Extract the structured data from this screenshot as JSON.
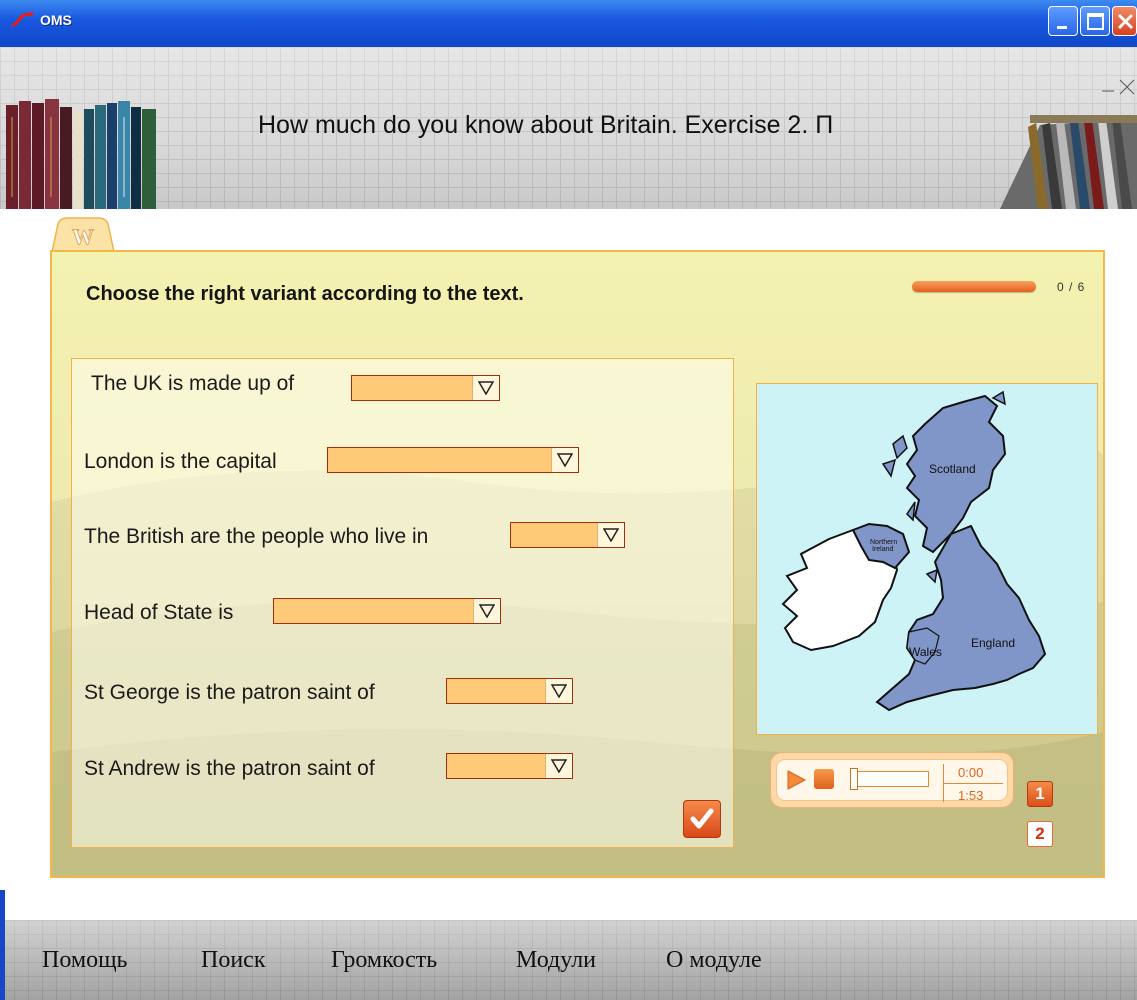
{
  "window": {
    "title": "OMS",
    "icon": "oms-logo-icon",
    "controls": [
      "minimize-icon",
      "maximize-icon",
      "close-icon"
    ]
  },
  "header": {
    "title": "How much do you know about Britain. Exercise 2. П"
  },
  "exercise": {
    "tab_icon": "w-tab-icon",
    "instruction": "Choose the right variant according to the text.",
    "progress": {
      "text": "0 / 6",
      "answered": 0,
      "total": 6
    },
    "questions": [
      {
        "text": "The UK is made up of",
        "selected": ""
      },
      {
        "text": "London is the capital",
        "selected": ""
      },
      {
        "text": "The British are the people who live in",
        "selected": ""
      },
      {
        "text": "Head of State is",
        "selected": ""
      },
      {
        "text": "St George is the patron saint of",
        "selected": ""
      },
      {
        "text": "St Andrew is the patron saint of",
        "selected": ""
      }
    ],
    "check_icon": "checkmark-icon"
  },
  "map": {
    "labels": {
      "scotland": "Scotland",
      "northern_ireland_1": "Northern",
      "northern_ireland_2": "Ireland",
      "wales": "Wales",
      "england": "England"
    },
    "colors": {
      "sea": "#cdf3f7",
      "uk": "#8096c8",
      "ireland": "#ffffff"
    }
  },
  "player": {
    "current_time": "0:00",
    "total_time": "1:53",
    "position": 0
  },
  "pages": [
    "1",
    "2"
  ],
  "active_page": "1",
  "footer_menu": [
    "Помощь",
    "Поиск",
    "Громкость",
    "Модули",
    "О модуле"
  ]
}
